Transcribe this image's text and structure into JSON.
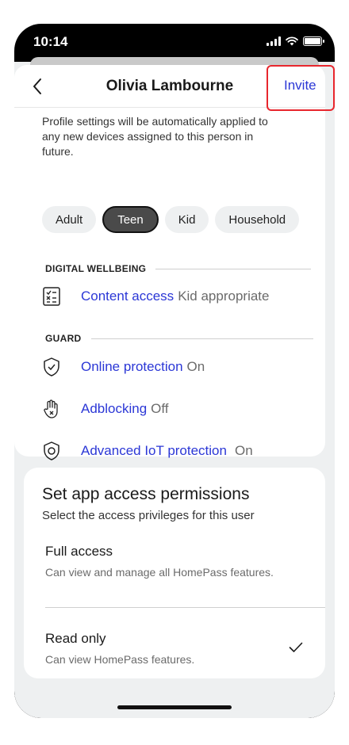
{
  "status_bar": {
    "time": "10:14"
  },
  "header": {
    "title": "Olivia Lambourne",
    "invite_label": "Invite"
  },
  "description": "Profile settings will be automatically applied to any new devices assigned to this person in future.",
  "profile_types": [
    {
      "label": "Adult",
      "selected": false
    },
    {
      "label": "Teen",
      "selected": true
    },
    {
      "label": "Kid",
      "selected": false
    },
    {
      "label": "Household",
      "selected": false
    }
  ],
  "digital_wellbeing": {
    "heading": "DIGITAL WELLBEING",
    "items": [
      {
        "label": "Content access",
        "value": "Kid appropriate",
        "icon": "checklist-icon"
      }
    ]
  },
  "guard": {
    "heading": "GUARD",
    "items": [
      {
        "label": "Online protection",
        "value": "On",
        "icon": "shield-check-icon"
      },
      {
        "label": "Adblocking",
        "value": "Off",
        "icon": "hand-block-icon"
      },
      {
        "label": "Advanced IoT protection",
        "value": "On",
        "icon": "iot-shield-icon"
      }
    ]
  },
  "permissions": {
    "title": "Set app access permissions",
    "subtitle": "Select the access privileges for this user",
    "options": [
      {
        "name": "Full access",
        "description": "Can view and manage all HomePass features.",
        "selected": false
      },
      {
        "name": "Read only",
        "description": "Can view HomePass features.",
        "selected": true
      }
    ]
  },
  "colors": {
    "link": "#2b37d6",
    "highlight": "#e8262d",
    "selected_chip": "#4a4a4a"
  }
}
